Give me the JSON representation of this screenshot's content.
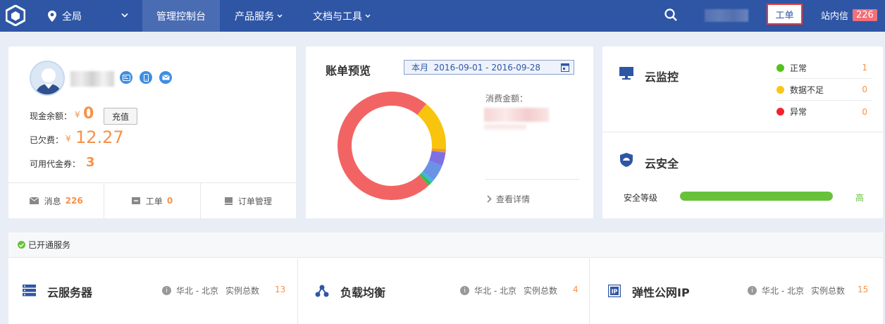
{
  "header": {
    "region": "全局",
    "tabs": [
      {
        "label": "管理控制台",
        "active": true
      },
      {
        "label": "产品服务",
        "active": false
      },
      {
        "label": "文档与工具",
        "active": false
      }
    ],
    "ticket_label": "工单",
    "inbox_label": "站内信",
    "inbox_count": "226",
    "brand_color": "#2f56a5"
  },
  "account": {
    "cash_label": "现金余额：",
    "cash_currency": "¥",
    "cash_value": "0",
    "recharge_label": "充值",
    "owed_label": "已欠费：",
    "owed_currency": "¥",
    "owed_value": "12.27",
    "voucher_label": "可用代金券：",
    "voucher_value": "3",
    "footer": [
      {
        "label": "消息",
        "count": "226",
        "icon": "mail-icon"
      },
      {
        "label": "工单",
        "count": "0",
        "icon": "ticket-icon"
      },
      {
        "label": "订单管理",
        "count": "",
        "icon": "order-icon"
      }
    ]
  },
  "bill": {
    "title": "账单预览",
    "range": "本月  2016-09-01 - 2016-09-28",
    "spend_label": "消费金额：",
    "detail_label": "查看详情",
    "chart_data": {
      "type": "pie",
      "values": [
        73,
        15,
        1,
        4,
        5,
        1,
        1
      ],
      "colors": [
        "#f26464",
        "#f8c40d",
        "#ef9a2a",
        "#7d70e5",
        "#6a92e6",
        "#3bb7e0",
        "#33c149"
      ]
    }
  },
  "monitor": {
    "title": "云监控",
    "statuses": [
      {
        "label": "正常",
        "count": "1",
        "color": "#52c41a"
      },
      {
        "label": "数据不足",
        "count": "0",
        "color": "#fac514"
      },
      {
        "label": "异常",
        "count": "0",
        "color": "#f5222d"
      }
    ]
  },
  "security": {
    "title": "云安全",
    "level_label": "安全等级",
    "level_value": "高",
    "level_fraction": 1.0
  },
  "services": {
    "header": "已开通服务",
    "items": [
      {
        "name": "云服务器",
        "region": "华北 - 北京",
        "count_label": "实例总数",
        "count": "13",
        "icon": "server-icon"
      },
      {
        "name": "负载均衡",
        "region": "华北 - 北京",
        "count_label": "实例总数",
        "count": "4",
        "icon": "load-balancer-icon"
      },
      {
        "name": "弹性公网IP",
        "region": "华北 - 北京",
        "count_label": "实例总数",
        "count": "15",
        "icon": "ip-icon"
      }
    ]
  }
}
